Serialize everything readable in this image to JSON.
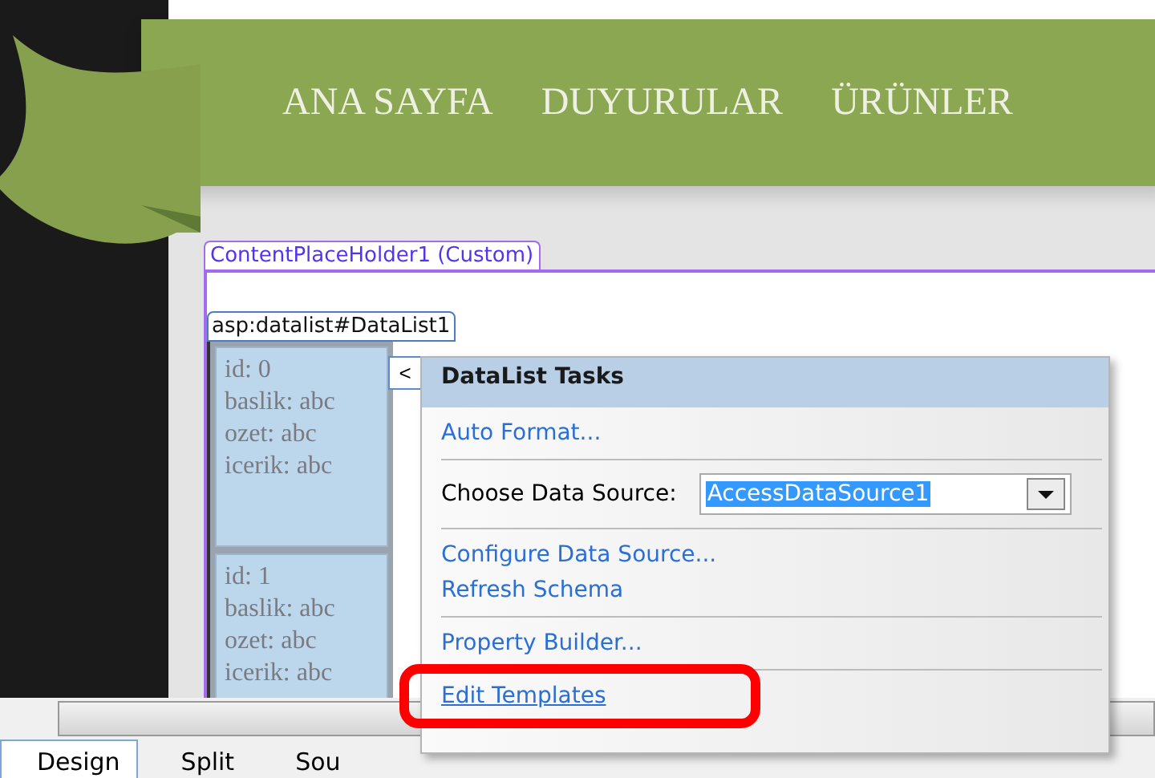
{
  "nav": [
    "ANA SAYFA",
    "DUYURULAR",
    "ÜRÜNLER"
  ],
  "placeholder_label": "ContentPlaceHolder1 (Custom)",
  "datalist_label": "asp:datalist#DataList1",
  "datalist_items": [
    [
      "id: 0",
      "baslik: abc",
      "ozet: abc",
      "icerik: abc"
    ],
    [
      "id: 1",
      "baslik: abc",
      "ozet: abc",
      "icerik: abc"
    ]
  ],
  "tasks": {
    "collapse_glyph": "<",
    "title": "DataList Tasks",
    "groups": [
      [
        {
          "kind": "link",
          "label": "Auto Format...",
          "highlighted": false
        }
      ],
      [
        {
          "kind": "dropdown",
          "label": "Choose Data Source:",
          "value": "AccessDataSource1"
        }
      ],
      [
        {
          "kind": "link",
          "label": "Configure Data Source...",
          "highlighted": false
        },
        {
          "kind": "link",
          "label": "Refresh Schema",
          "highlighted": false
        }
      ],
      [
        {
          "kind": "link",
          "label": "Property Builder...",
          "highlighted": false
        }
      ],
      [
        {
          "kind": "link",
          "label": "Edit Templates",
          "highlighted": true
        }
      ]
    ]
  },
  "view_tabs": [
    {
      "label": "Design",
      "selected": true
    },
    {
      "label": "Split",
      "selected": false
    },
    {
      "label": "Sou",
      "selected": false
    }
  ]
}
